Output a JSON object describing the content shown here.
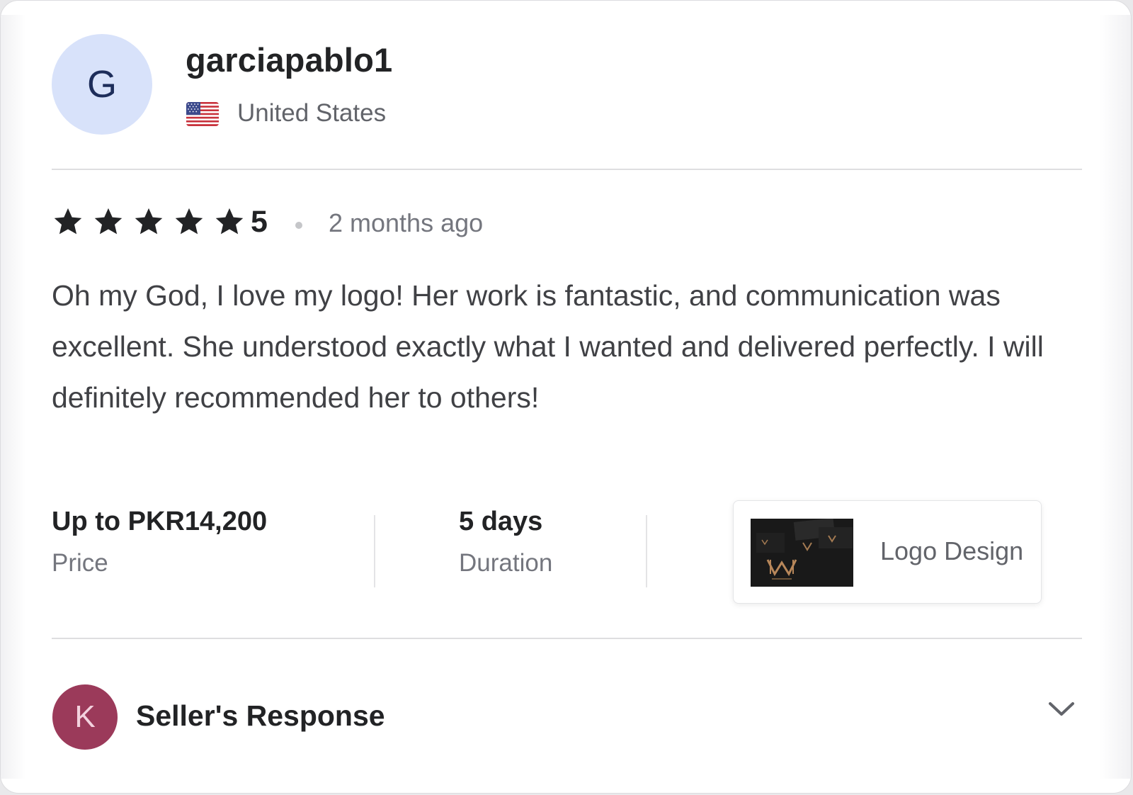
{
  "reviewer": {
    "avatar_initial": "G",
    "username": "garciapablo1",
    "country": "United States",
    "flag_icon": "us-flag-icon"
  },
  "rating": {
    "stars": 5,
    "value": "5",
    "time_ago": "2 months ago"
  },
  "review_text": "Oh my God, I love my logo! Her work is fantastic, and communication was excellent. She understood exactly what I wanted and delivered perfectly. I will definitely recommended her to others!",
  "stats": {
    "price_value": "Up to PKR14,200",
    "price_label": "Price",
    "duration_value": "5 days",
    "duration_label": "Duration"
  },
  "service": {
    "name": "Logo Design"
  },
  "seller_response": {
    "avatar_initial": "K",
    "title": "Seller's Response",
    "expand_icon": "chevron-down-icon"
  },
  "colors": {
    "reviewer_avatar_bg": "#d8e2fa",
    "seller_avatar_bg": "#9b3a5a",
    "star": "#222325",
    "text_primary": "#222325",
    "text_secondary": "#74767e"
  }
}
